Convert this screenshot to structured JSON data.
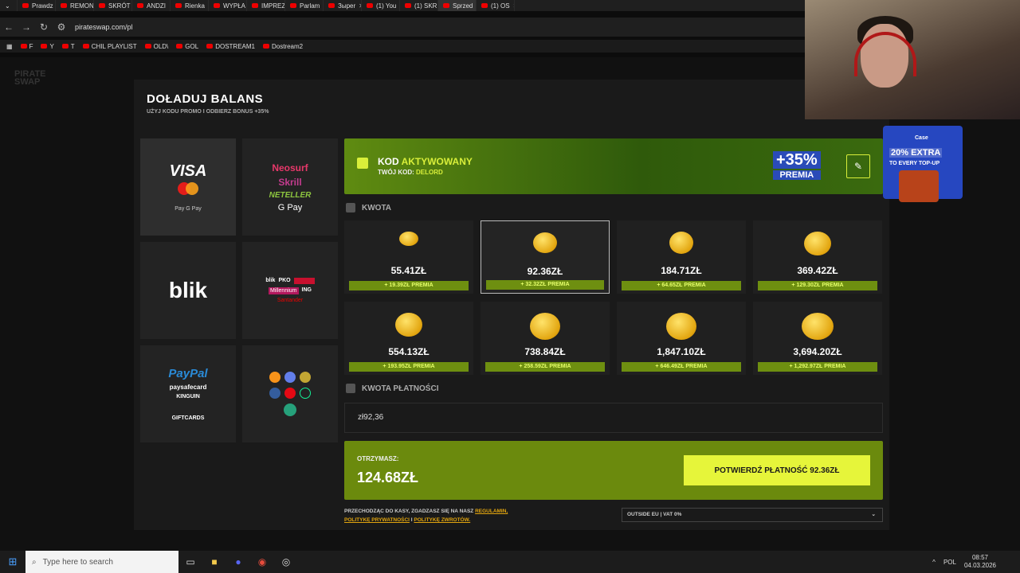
{
  "browser": {
    "tabs": [
      "Prawdz",
      "REMON",
      "SKRÓT",
      "ANDZI",
      "Rienka",
      "WYPŁA",
      "IMPREZ",
      "Parlam",
      "Зыреr",
      "(1) You",
      "(1) SKR",
      "Sprzed",
      "(1) OS"
    ],
    "url": "pirateswap.com/pl",
    "bookmarks": [
      "F",
      "Y",
      "T",
      "CHIL PLAYLIST",
      "OLD\\",
      "GOL",
      "DOSTREAM1",
      "Dostream2"
    ]
  },
  "site": {
    "logo_line1": "PIRATE",
    "logo_line2": "SWAP"
  },
  "modal": {
    "title": "DOŁADUJ BALANS",
    "subtitle": "UŻYJ KODU PROMO I ODBIERZ BONUS +35%",
    "payment_methods": {
      "visa": "VISA",
      "wallets": " Pay  G Pay",
      "neosurf": "Neosurf",
      "skrill": "Skrill",
      "neteller": "NETELLER",
      "gpay": "G Pay",
      "blik": "blik",
      "bank_blik": "blik",
      "bank_pko": "PKO",
      "bank_millennium": "Millennium",
      "bank_ing": "ING",
      "bank_santander": "Santander",
      "paypal": "PayPal",
      "paysafe": "paysafecard",
      "kinguin": "KINGUIN",
      "giftcards": "GIFTCARDS"
    },
    "code_banner": {
      "status_prefix": "KOD",
      "status_word": "AKTYWOWANY",
      "code_label": "TWÓJ KOD:",
      "code_value": "DELORD",
      "premia_pct": "+35%",
      "premia_label": "PREMIA"
    },
    "amount_label": "KWOTA",
    "amounts": [
      {
        "value": "55.41ZŁ",
        "bonus": "+ 19.39ZŁ PREMIA"
      },
      {
        "value": "92.36ZŁ",
        "bonus": "+ 32.32ZŁ PREMIA"
      },
      {
        "value": "184.71ZŁ",
        "bonus": "+ 64.65ZŁ PREMIA"
      },
      {
        "value": "369.42ZŁ",
        "bonus": "+ 129.30ZŁ PREMIA"
      },
      {
        "value": "554.13ZŁ",
        "bonus": "+ 193.95ZŁ PREMIA"
      },
      {
        "value": "738.84ZŁ",
        "bonus": "+ 258.59ZŁ PREMIA"
      },
      {
        "value": "1,847.10ZŁ",
        "bonus": "+ 646.49ZŁ PREMIA"
      },
      {
        "value": "3,694.20ZŁ",
        "bonus": "+ 1,292.97ZŁ PREMIA"
      }
    ],
    "payment_amount_label": "KWOTA PŁATNOŚCI",
    "payment_amount_value": "zł92,36",
    "receive_label": "OTRZYMASZ:",
    "receive_value": "124.68ZŁ",
    "confirm_label": "POTWIERDŹ PŁATNOŚĆ 92.36ZŁ",
    "legal_text": "PRZECHODZĄC DO KASY, ZGADZASZ SIĘ NA NASZ",
    "legal_link1": "REGULAMIN,",
    "legal_link2": "POLITYKĘ PRYWATNOŚCI",
    "legal_and": " I ",
    "legal_link3": "POLITYKĘ ZWROTÓW.",
    "region": "OUTSIDE EU | VAT 0%"
  },
  "ad": {
    "brand": "Case",
    "headline": "20% EXTRA",
    "sub": "TO EVERY TOP-UP"
  },
  "taskbar": {
    "search_placeholder": "Type here to search",
    "lang": "POL",
    "time": "08:57",
    "date": "04.03.2026"
  }
}
